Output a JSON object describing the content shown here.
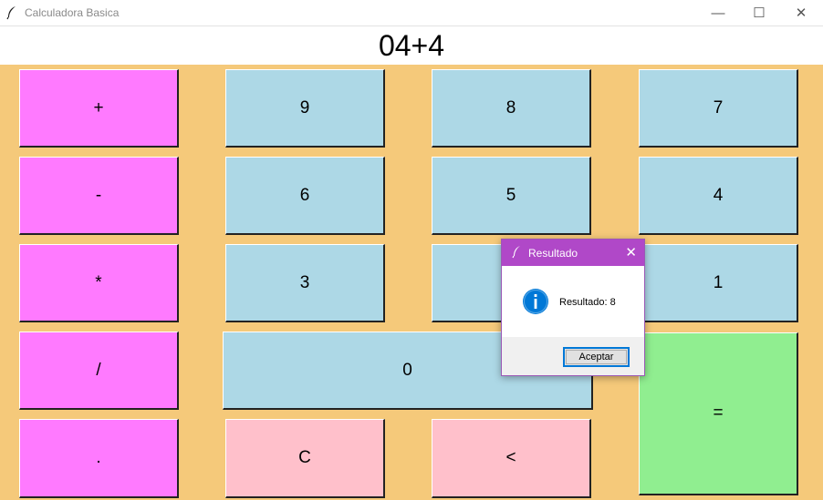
{
  "window": {
    "title": "Calculadora Basica",
    "controls": {
      "minimize": "—",
      "maximize": "☐",
      "close": "✕"
    }
  },
  "display": {
    "value": "04+4"
  },
  "buttons": {
    "plus": "+",
    "minus": "-",
    "multiply": "*",
    "divide": "/",
    "dot": ".",
    "n9": "9",
    "n8": "8",
    "n7": "7",
    "n6": "6",
    "n5": "5",
    "n4": "4",
    "n3": "3",
    "n1": "1",
    "n0": "0",
    "clear": "C",
    "backspace": "<",
    "equals": "="
  },
  "dialog": {
    "title": "Resultado",
    "close": "✕",
    "message": "Resultado: 8",
    "ok_label": "Aceptar",
    "icon": "info-icon"
  },
  "colors": {
    "background": "#f5c97a",
    "operator": "#ff7aff",
    "number": "#add8e6",
    "clear": "#ffc0cb",
    "equals": "#90ee90",
    "dialog_title": "#b048c8",
    "info_blue": "#0078d7"
  }
}
